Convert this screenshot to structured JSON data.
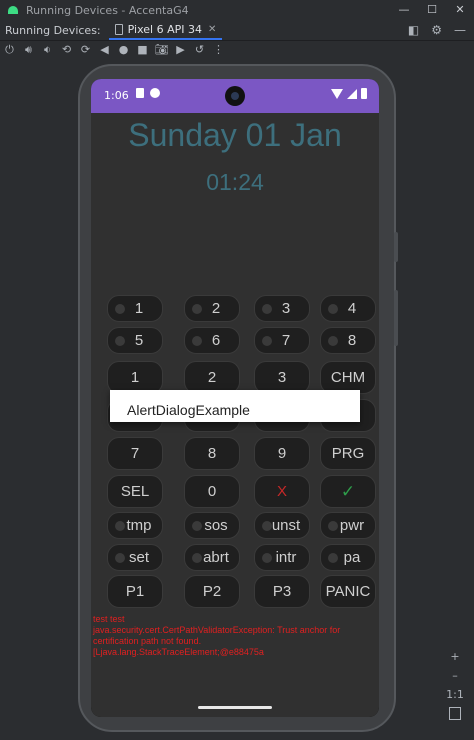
{
  "window": {
    "title": "Running Devices - AccentaG4",
    "controls": [
      "—",
      "☐",
      "✕"
    ]
  },
  "tabbar": {
    "label": "Running Devices:",
    "tab": "Pixel 6 API 34",
    "close": "✕"
  },
  "toolbar": {
    "icons": [
      "power-icon",
      "volume-up-icon",
      "volume-down-icon",
      "rotate-left-icon",
      "rotate-right-icon",
      "back-icon",
      "home-icon",
      "overview-icon",
      "screenshot-icon",
      "screen-record-icon",
      "reset-icon",
      "more-icon"
    ]
  },
  "zoom": {
    "plus": "+",
    "minus": "–",
    "one_to_one": "1:1"
  },
  "status": {
    "time": "1:06"
  },
  "app": {
    "date": "Sunday 01  Jan",
    "time": "01:24",
    "dialog_title": "AlertDialogExample",
    "errors": [
      "test test",
      "java.security.cert.CertPathValidatorException: Trust anchor for",
      "certification path not found.",
      "[Ljava.lang.StackTraceElement;@e88475a"
    ]
  },
  "keys": {
    "row1": [
      "1",
      "2",
      "3",
      "4"
    ],
    "row2": [
      "5",
      "6",
      "7",
      "8"
    ],
    "row3": [
      "1",
      "2",
      "3",
      "CHM"
    ],
    "row4": [
      "",
      "",
      "",
      "+"
    ],
    "row5": [
      "7",
      "8",
      "9",
      "PRG"
    ],
    "row6": [
      "SEL",
      "0",
      "X",
      "✓"
    ],
    "row7": [
      "tmp",
      "sos",
      "unst",
      "pwr"
    ],
    "row8": [
      "set",
      "abrt",
      "intr",
      "pa"
    ],
    "row9": [
      "P1",
      "P2",
      "P3",
      "PANIC"
    ]
  },
  "colors": {
    "accent_status_bar": "#7b57c4",
    "app_background": "#303030",
    "date_text": "#3d6f7d",
    "error_text": "#e02020"
  }
}
